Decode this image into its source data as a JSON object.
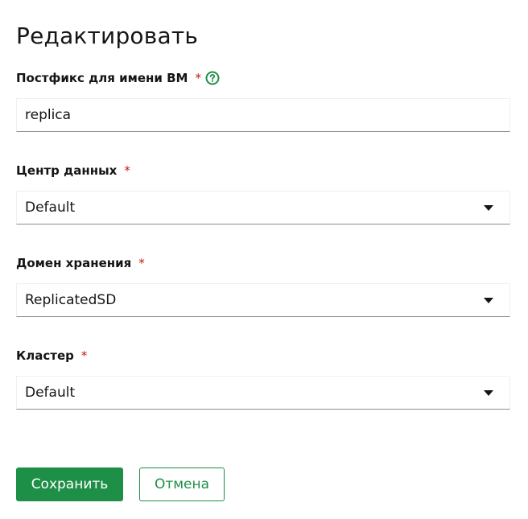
{
  "dialog": {
    "title": "Редактировать"
  },
  "fields": [
    {
      "label": "Постфикс для имени ВМ",
      "required_mark": "*",
      "value": "replica",
      "has_help": true,
      "type": "text"
    },
    {
      "label": "Центр данных",
      "required_mark": "*",
      "value": "Default",
      "type": "select"
    },
    {
      "label": "Домен хранения",
      "required_mark": "*",
      "value": "ReplicatedSD",
      "type": "select"
    },
    {
      "label": "Кластер",
      "required_mark": "*",
      "value": "Default",
      "type": "select"
    }
  ],
  "actions": {
    "save_label": "Сохранить",
    "cancel_label": "Отмена"
  },
  "colors": {
    "accent": "#1e8f47",
    "required": "#c9190b",
    "help_icon": "#1e8f47"
  },
  "icons": {
    "help": "question-circle-icon",
    "dropdown": "caret-down-icon"
  }
}
